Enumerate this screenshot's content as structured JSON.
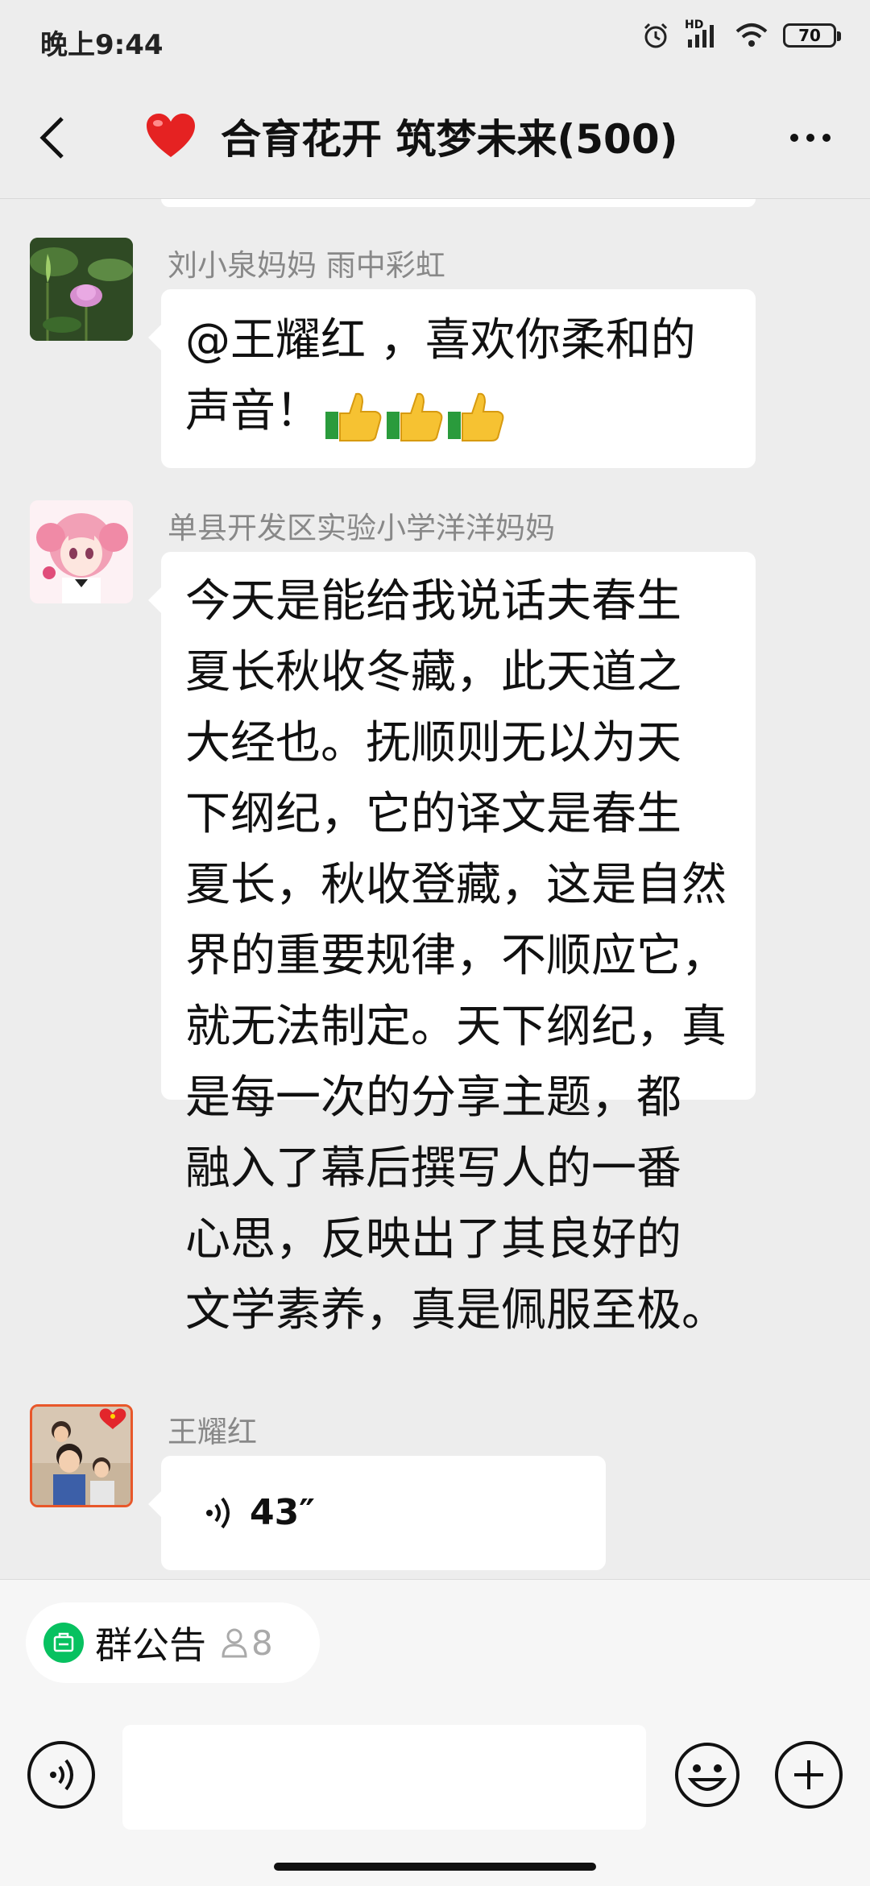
{
  "status_bar": {
    "time": "晚上9:44",
    "battery": "70",
    "network_label": "HD",
    "icons": [
      "alarm-icon",
      "signal-icon",
      "wifi-icon",
      "battery-icon"
    ]
  },
  "header": {
    "title": "合育花开 筑梦未来(500)",
    "title_emoji": "❤️"
  },
  "messages": [
    {
      "sender": "刘小泉妈妈  雨中彩虹",
      "text_line1": "@王耀红 ，喜欢你柔和的",
      "text_line2": "声音！",
      "emoji": "👍👍👍"
    },
    {
      "sender": "单县开发区实验小学洋洋妈妈",
      "lines": [
        "今天是能给我说话夫春生",
        "夏长秋收冬藏，此天道之",
        "大经也。抚顺则无以为天",
        "下纲纪，它的译文是春生",
        "夏长，秋收登藏，这是自然",
        "界的重要规律，不顺应它，",
        "就无法制定。天下纲纪，真",
        "是每一次的分享主题，都",
        "融入了幕后撰写人的一番",
        "心思，反映出了其良好的",
        "文学素养，真是佩服至极。"
      ]
    },
    {
      "sender": "王耀红",
      "voice_duration": "43″"
    }
  ],
  "bottom_bar": {
    "notice_label": "群公告",
    "notice_count": "8"
  },
  "colors": {
    "background": "#ededed",
    "bubble": "#ffffff",
    "accent_green": "#07c160"
  }
}
